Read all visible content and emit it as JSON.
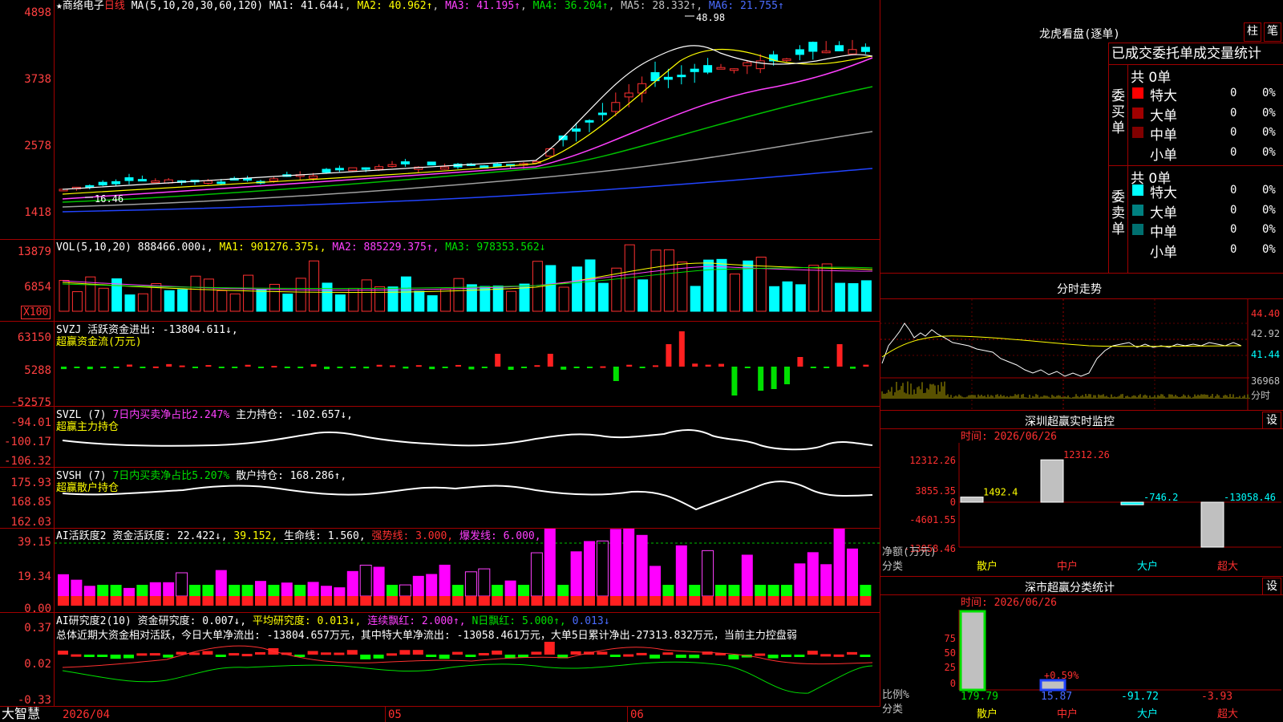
{
  "main": {
    "star": "★",
    "stock_name": "商络电子",
    "period": "日线",
    "ma_header": "MA(5,10,20,30,60,120)",
    "ma": [
      {
        "label": "MA1:",
        "value": "41.644↓",
        "color": "#ffffff"
      },
      {
        "label": "MA2:",
        "value": "40.962↑",
        "color": "#ffff00"
      },
      {
        "label": "MA3:",
        "value": "41.195↑",
        "color": "#ff40ff"
      },
      {
        "label": "MA4:",
        "value": "36.204↑",
        "color": "#00e000"
      },
      {
        "label": "MA5:",
        "value": "28.332↑",
        "color": "#c0c0c0"
      },
      {
        "label": "MA6:",
        "value": "21.755↑",
        "color": "#4a6cff"
      }
    ],
    "y_ticks": [
      "4898",
      "3738",
      "2578",
      "1418"
    ],
    "high_label": "48.98",
    "low_label": "16.46",
    "date_labels": [
      "2026/04",
      "05",
      "06"
    ],
    "brand": "大智慧"
  },
  "vol": {
    "header": "VOL(5,10,20)",
    "value": "888466.000↓,",
    "ma1": "MA1: 901276.375↓,",
    "ma2": "MA2: 885229.375↑,",
    "ma3": "MA3: 978353.562↓",
    "y_ticks": [
      "13879",
      "6854"
    ],
    "unit": "X100"
  },
  "svzj": {
    "header": "SVZJ",
    "text": "活跃资金进出: -13804.611↓,",
    "subtitle": "超赢资金流(万元)",
    "y_ticks": [
      "63150",
      "5288",
      "-52575"
    ]
  },
  "svzl": {
    "header": "SVZL (7)",
    "pct": "7日内买卖净占比2.247%",
    "text": "主力持仓: -102.657↓,",
    "subtitle": "超赢主力持仓",
    "y_ticks": [
      "-94.01",
      "-100.17",
      "-106.32"
    ]
  },
  "svsh": {
    "header": "SVSH (7)",
    "pct": "7日内买卖净占比5.207%",
    "text": "散户持仓: 168.286↑,",
    "subtitle": "超赢散户持仓",
    "y_ticks": [
      "175.93",
      "168.85",
      "162.03"
    ]
  },
  "ai1": {
    "header": "AI活跃度2",
    "v1": "资金活跃度: 22.422↓,",
    "v2": "39.152,",
    "v3": "生命线: 1.560,",
    "v4": "强势线: 3.000,",
    "v5": "爆发线: 6.000,",
    "y_ticks": [
      "39.15",
      "19.34",
      "0.00"
    ]
  },
  "ai2": {
    "header": "AI研究度2(10)",
    "v1": "资金研究度: 0.007↓,",
    "v2": "平均研究度: 0.013↓,",
    "v3": "连续飘红: 2.000↑,",
    "v4": "N日飘红: 5.000↑,",
    "v5": "0.013↓",
    "summary": "总体近期大资金相对活跃，今日大单净流出: -13804.657万元，其中特大单净流出: -13058.461万元，大单5日累计净出-27313.832万元，当前主力控盘弱",
    "y_ticks": [
      "0.37",
      "0.02",
      "-0.33"
    ]
  },
  "right": {
    "lhb_title": "龙虎看盘(逐单)",
    "btn_zhu": "柱",
    "btn_bi": "笔",
    "tabs": "已成交委托单成交量统计",
    "buy_side": "委买单",
    "sell_side": "委卖单",
    "buy_total": "共 0单",
    "sell_total": "共 0单",
    "buy_rows": [
      {
        "label": "特大",
        "count": "0",
        "pct": "0%",
        "color": "#ff0000"
      },
      {
        "label": "大单",
        "count": "0",
        "pct": "0%",
        "color": "#a00000"
      },
      {
        "label": "中单",
        "count": "0",
        "pct": "0%",
        "color": "#800000"
      },
      {
        "label": "小单",
        "count": "0",
        "pct": "0%",
        "color": "#000000"
      }
    ],
    "sell_rows": [
      {
        "label": "特大",
        "count": "0",
        "pct": "0%",
        "color": "#00ffff"
      },
      {
        "label": "大单",
        "count": "0",
        "pct": "0%",
        "color": "#008080"
      },
      {
        "label": "中单",
        "count": "0",
        "pct": "0%",
        "color": "#007070"
      },
      {
        "label": "小单",
        "count": "0",
        "pct": "0%",
        "color": "#000000"
      }
    ],
    "intraday_title": "分时走势",
    "intraday_ticks": [
      "44.40",
      "42.92",
      "41.44"
    ],
    "intraday_vol": "36968",
    "intraday_unit": "分时",
    "monitor_title": "深圳超赢实时监控",
    "monitor_btn": "设",
    "monitor_time": "时间: 2026/06/26",
    "monitor_ticks": [
      "12312.26",
      "3855.35",
      "0",
      "-4601.55",
      "-13058.46"
    ],
    "monitor_axis_label": "净额(万元)",
    "monitor_axis_label2": "分类",
    "monitor_values": [
      "1492.4",
      "12312.26",
      "-746.2",
      "-13058.46"
    ],
    "categories": [
      "散户",
      "中户",
      "大户",
      "超大"
    ],
    "stats_title": "深市超赢分类统计",
    "stats_btn": "设",
    "stats_time": "时间: 2026/06/26",
    "stats_ticks": [
      "75",
      "50",
      "25",
      "0"
    ],
    "stats_axis_label": "比例%",
    "stats_axis_label2": "分类",
    "stats_values": [
      "179.79",
      "15.87",
      "-91.72",
      "-3.93"
    ],
    "stats_note": "+0.59%"
  }
}
